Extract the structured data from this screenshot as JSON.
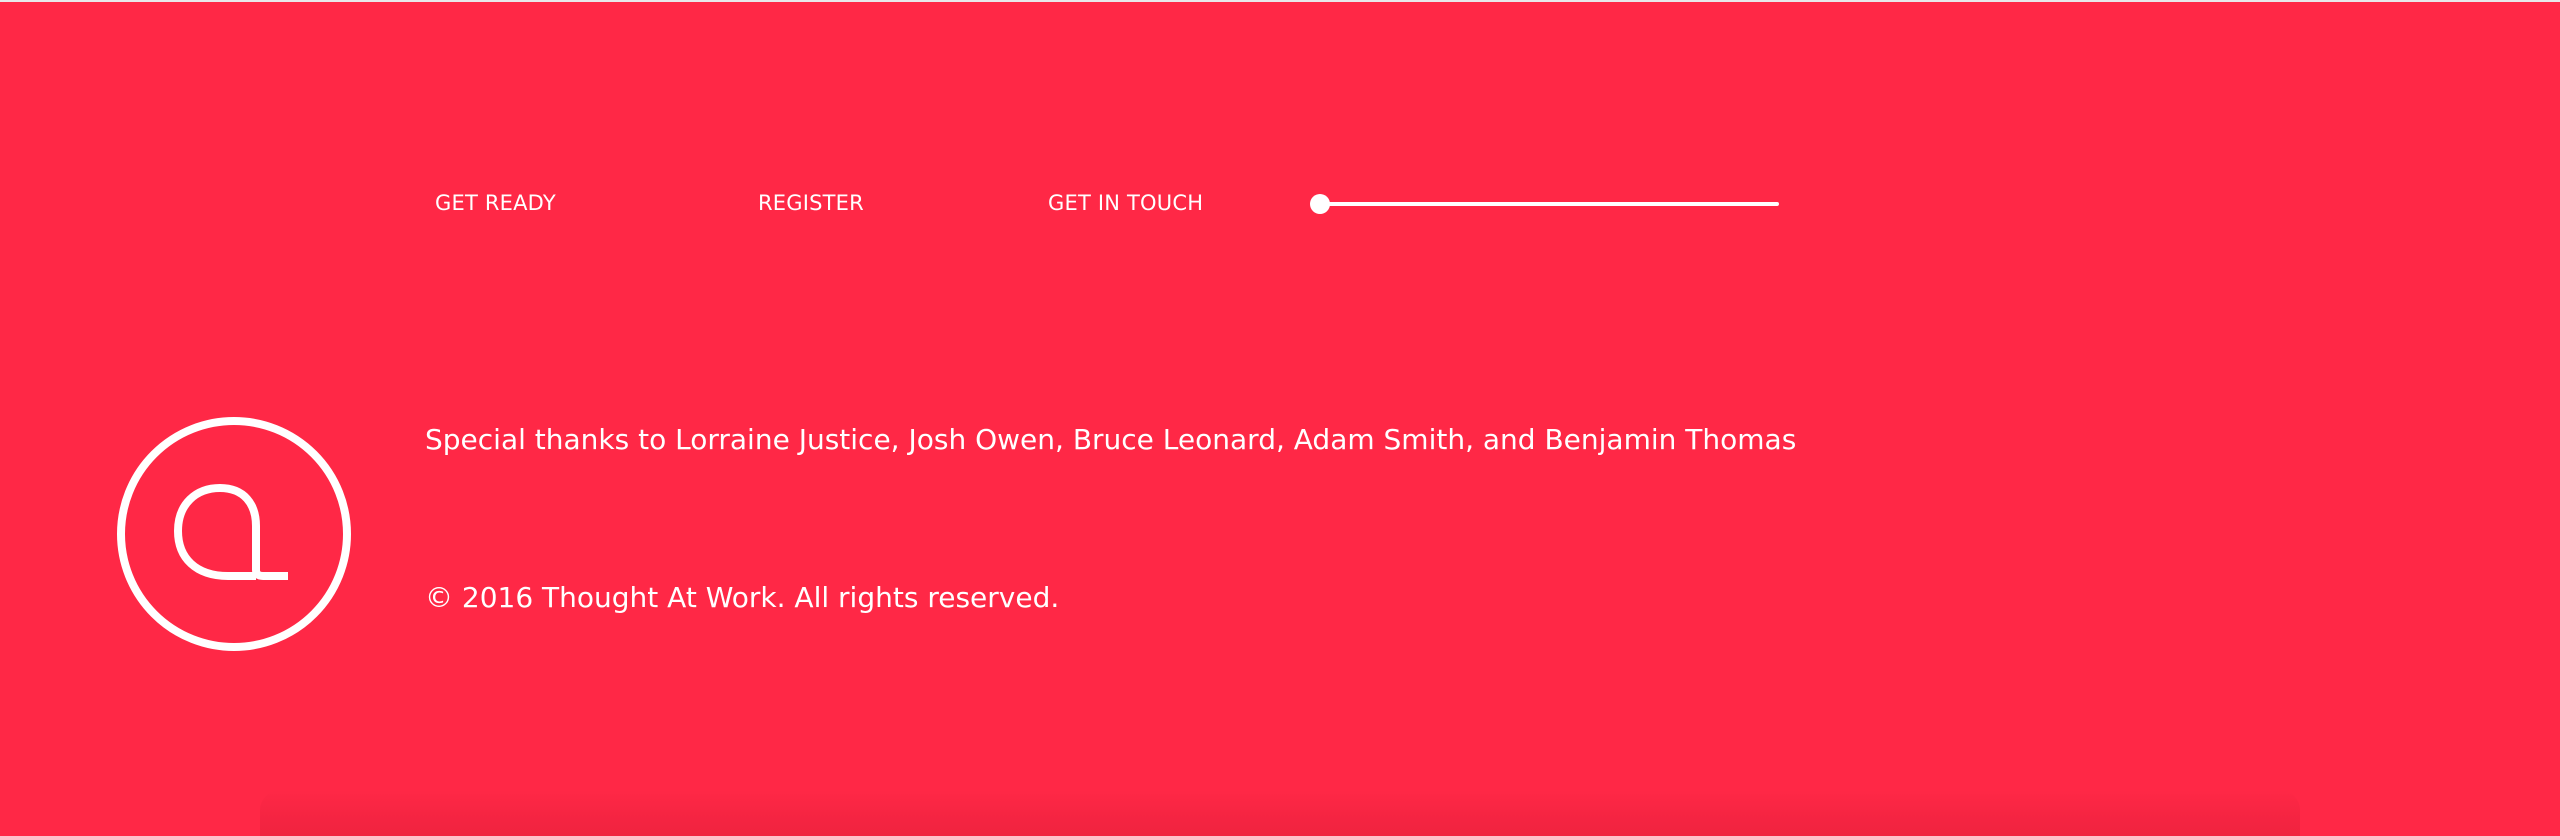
{
  "nav": {
    "items": [
      {
        "label": "GET READY"
      },
      {
        "label": "REGISTER"
      },
      {
        "label": "GET IN TOUCH"
      }
    ],
    "progress_fraction": 0.0
  },
  "logo": {
    "icon": "at-sign-circle-icon"
  },
  "footer": {
    "credits": "Special thanks to Lorraine Justice, Josh Owen, Bruce Leonard, Adam Smith, and Benjamin Thomas",
    "copyright": "© 2016 Thought At Work. All rights reserved."
  },
  "colors": {
    "background": "#FF2846",
    "foreground": "#FFFFFF"
  }
}
